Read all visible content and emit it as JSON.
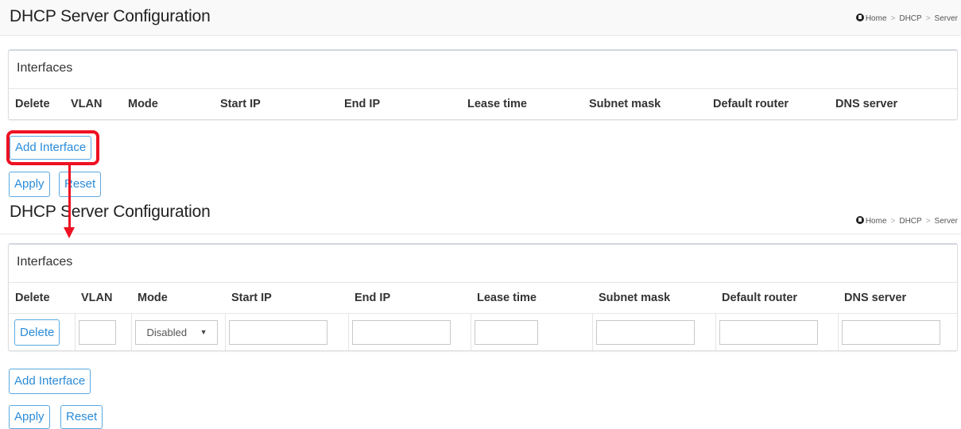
{
  "screens": [
    {
      "title": "DHCP Server Configuration",
      "breadcrumb": [
        "Home",
        "DHCP",
        "Server"
      ],
      "section_title": "Interfaces",
      "columns": [
        "Delete",
        "VLAN",
        "Mode",
        "Start IP",
        "End IP",
        "Lease time",
        "Subnet mask",
        "Default router",
        "DNS server"
      ],
      "rows": [],
      "buttons": {
        "add_interface": "Add Interface",
        "apply": "Apply",
        "reset": "Reset"
      }
    },
    {
      "title": "DHCP Server Configuration",
      "breadcrumb": [
        "Home",
        "DHCP",
        "Server"
      ],
      "section_title": "Interfaces",
      "columns": [
        "Delete",
        "VLAN",
        "Mode",
        "Start IP",
        "End IP",
        "Lease time",
        "Subnet mask",
        "Default router",
        "DNS server"
      ],
      "rows": [
        {
          "delete_label": "Delete",
          "vlan": "",
          "mode": "Disabled",
          "start_ip": "",
          "end_ip": "",
          "lease_time": "",
          "subnet_mask": "",
          "default_router": "",
          "dns_server": ""
        }
      ],
      "buttons": {
        "add_interface": "Add Interface",
        "apply": "Apply",
        "reset": "Reset"
      }
    }
  ],
  "annotation": {
    "highlight_color": "#ee1122",
    "target": "Add Interface"
  },
  "colors": {
    "button_text": "#2a8bd8",
    "button_border": "#5aa9e0",
    "header_bg": "#f9f9f9"
  }
}
